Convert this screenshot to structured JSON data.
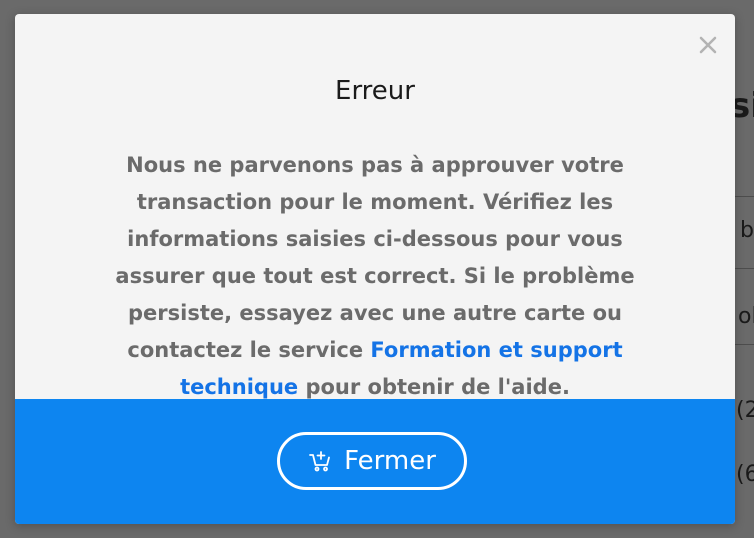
{
  "background": {
    "fragments": [
      "si",
      "b",
      "ol",
      "(2",
      "(6"
    ]
  },
  "dialog": {
    "title": "Erreur",
    "message_before_link": "Nous ne parvenons pas à approuver votre transaction pour le moment. Vérifiez les informations saisies ci-dessous pour vous assurer que tout est correct. Si le problème persiste, essayez avec une autre carte ou contactez le service ",
    "link_text": "Formation et support technique",
    "message_after_link": " pour obtenir de l'aide.",
    "close_icon": "close-icon",
    "primary_button": {
      "label": "Fermer",
      "icon": "cart-add-icon"
    }
  },
  "colors": {
    "accent": "#0d85f0",
    "link": "#1473e6",
    "text_muted": "#6b6b6b",
    "title": "#1b1b1b",
    "dialog_bg": "#f4f4f4",
    "overlay": "#6a6a6a"
  }
}
